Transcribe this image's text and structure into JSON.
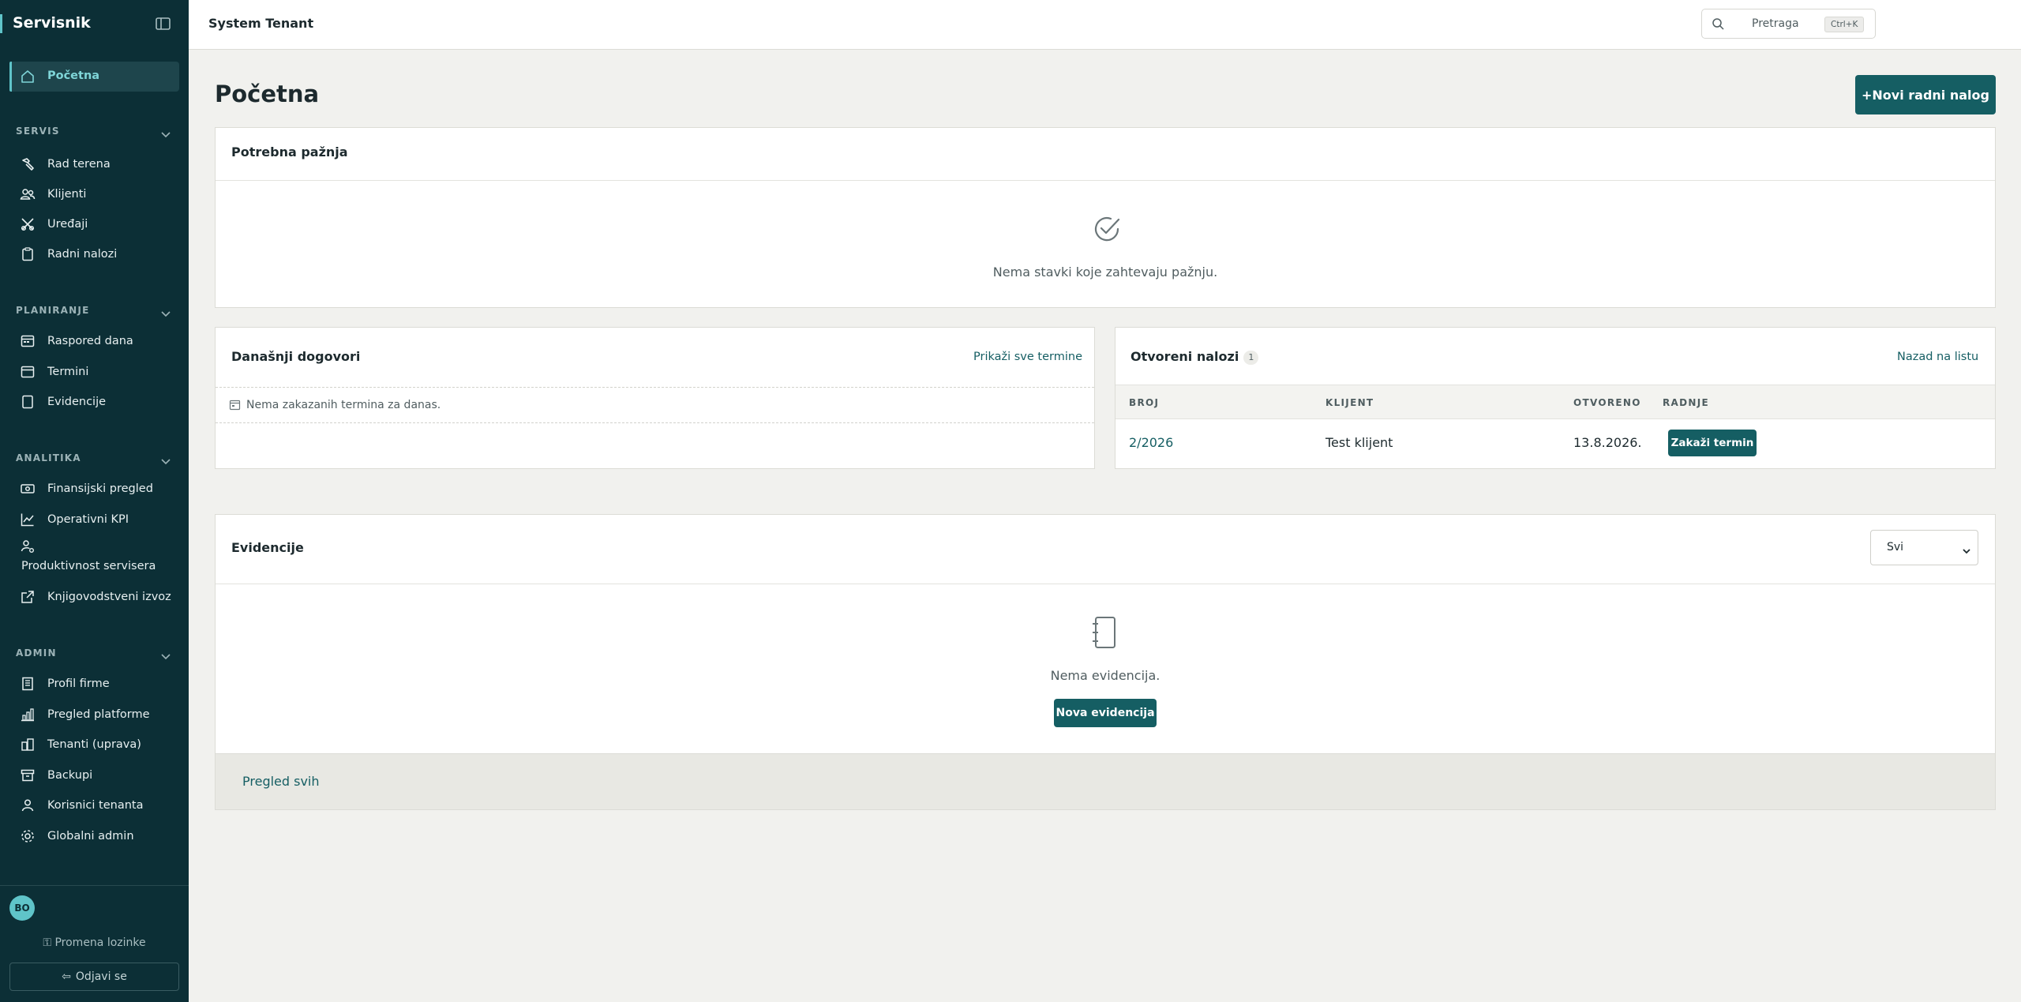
{
  "app": {
    "brand": "Servisnik",
    "tenant": "System Tenant"
  },
  "search": {
    "placeholder": "Pretraga",
    "shortcut": "Ctrl+K"
  },
  "sidebar": {
    "home": {
      "label": "Početna",
      "icon": "home-icon"
    },
    "sections": [
      {
        "title": "SERVIS",
        "items": [
          {
            "label": "Rad terena",
            "icon": "hammer-icon"
          },
          {
            "label": "Klijenti",
            "icon": "users-icon"
          },
          {
            "label": "Uređaji",
            "icon": "tools-icon"
          },
          {
            "label": "Radni nalozi",
            "icon": "clipboard-icon"
          }
        ]
      },
      {
        "title": "PLANIRANJE",
        "items": [
          {
            "label": "Raspored dana",
            "icon": "calendar-days-icon"
          },
          {
            "label": "Termini",
            "icon": "calendar-icon"
          },
          {
            "label": "Evidencije",
            "icon": "notebook-icon"
          }
        ]
      },
      {
        "title": "ANALITIKA",
        "items": [
          {
            "label": "Finansijski pregled",
            "icon": "money-icon"
          },
          {
            "label": "Operativni KPI",
            "icon": "line-chart-icon"
          },
          {
            "label": "Produktivnost servisera",
            "icon": "user-gear-icon"
          },
          {
            "label": "Knjigovodstveni izvoz",
            "icon": "external-link-icon"
          }
        ]
      },
      {
        "title": "ADMIN",
        "items": [
          {
            "label": "Profil firme",
            "icon": "building-icon"
          },
          {
            "label": "Pregled platforme",
            "icon": "bar-chart-icon"
          },
          {
            "label": "Tenanti (uprava)",
            "icon": "buildings-icon"
          },
          {
            "label": "Backupi",
            "icon": "archive-icon"
          },
          {
            "label": "Korisnici tenanta",
            "icon": "user-icon"
          },
          {
            "label": "Globalni admin",
            "icon": "gear-icon"
          }
        ]
      }
    ],
    "user_initials": "BO",
    "change_password": "Promena lozinke",
    "logout": "Odjavi se"
  },
  "main": {
    "title": "Početna",
    "new_order_button": "+Novi radni nalog",
    "attention": {
      "title": "Potrebna pažnja",
      "empty": "Nema stavki koje zahtevaju pažnju."
    },
    "today": {
      "title": "Današnji dogovori",
      "link": "Prikaži sve termine",
      "empty": "Nema zakazanih termina za danas."
    },
    "open_orders": {
      "title": "Otvoreni nalozi",
      "count": "1",
      "link": "Nazad na listu",
      "columns": [
        "BROJ",
        "KLIJENT",
        "OTVORENO",
        "RADNJE"
      ],
      "rows": [
        {
          "number": "2/2026",
          "client": "Test klijent",
          "opened": "13.8.2026.",
          "action": "Zakaži termin"
        }
      ]
    },
    "records": {
      "title": "Evidencije",
      "filter_value": "Svi",
      "empty": "Nema evidencija.",
      "new_button": "Nova evidencija",
      "footer_link": "Pregled svih"
    }
  },
  "colors": {
    "sidebar_bg": "#0c2f36",
    "accent": "#5fc4c9",
    "primary": "#155e63",
    "page_bg": "#f1f1ee"
  }
}
